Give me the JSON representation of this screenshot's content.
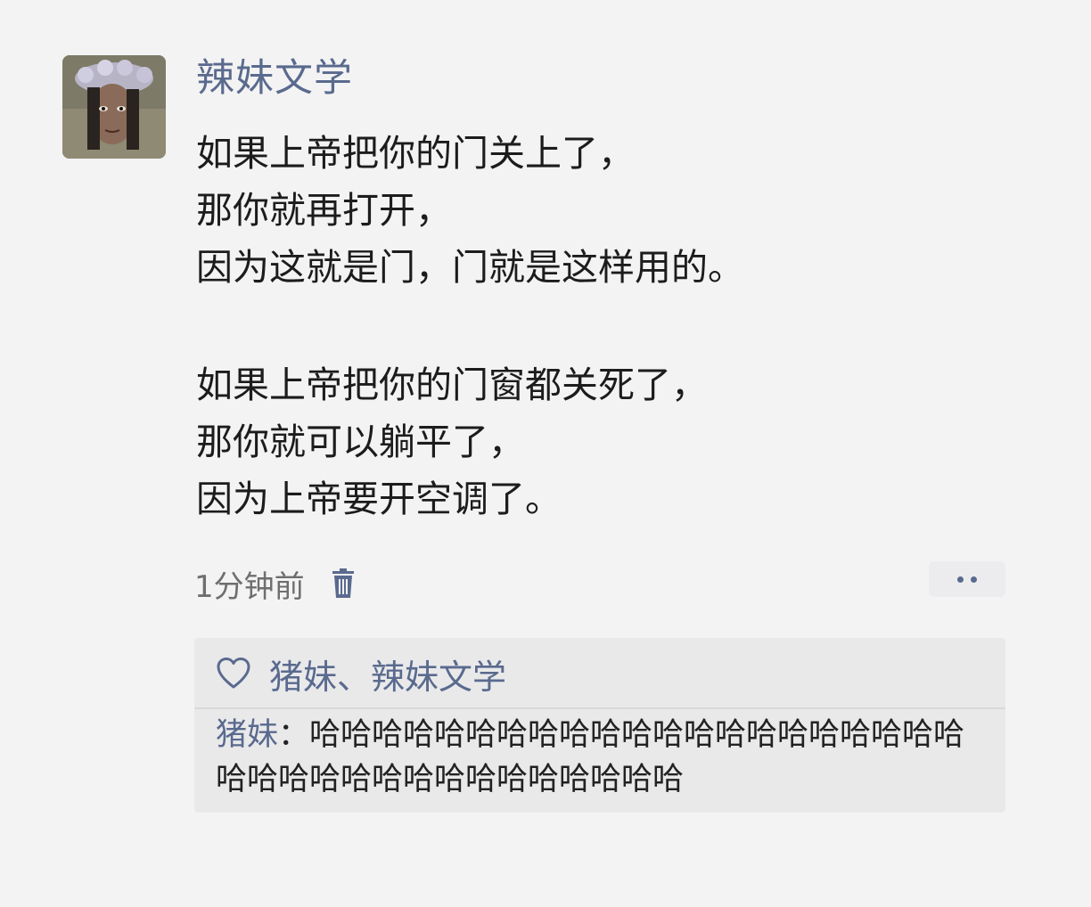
{
  "post": {
    "username": "辣妹文学",
    "paragraphs": [
      [
        "如果上帝把你的门关上了，",
        "那你就再打开，",
        "因为这就是门，门就是这样用的。"
      ],
      [
        "如果上帝把你的门窗都关死了，",
        "那你就可以躺平了，",
        "因为上帝要开空调了。"
      ]
    ],
    "timestamp": "1分钟前"
  },
  "likes": {
    "names": "猪妹、辣妹文学"
  },
  "comments": [
    {
      "author": "猪妹",
      "separator": "：",
      "text": "哈哈哈哈哈哈哈哈哈哈哈哈哈哈哈哈哈哈哈哈哈哈哈哈哈哈哈哈哈哈哈哈哈哈哈哈"
    }
  ],
  "icons": {
    "delete": "trash-icon",
    "more": "more-options-icon",
    "like": "heart-icon"
  },
  "colors": {
    "name_blue": "#5a6a8e",
    "background": "#f3f3f3",
    "comment_box": "#e9e9ea"
  }
}
